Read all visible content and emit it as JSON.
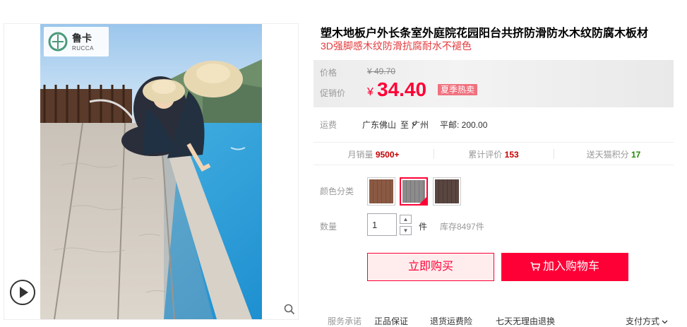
{
  "product": {
    "title": "塑木地板户外长条室外庭院花园阳台共挤防滑防水木纹防腐木板材",
    "subtitle": "3D强脚感木纹防滑抗腐耐水不褪色"
  },
  "brand": {
    "name_cn": "鲁卡",
    "name_en": "RUCCA"
  },
  "price": {
    "original_label": "价格",
    "original_value": "¥ 49.70",
    "promo_label": "促销价",
    "currency": "¥",
    "promo_value": "34.40",
    "promo_tag": "夏季热卖"
  },
  "shipping": {
    "label": "运费",
    "from": "广东佛山",
    "to_label": "至",
    "to": "广州",
    "fee": "平邮: 200.00"
  },
  "stats": {
    "monthly_sales_label": "月销量",
    "monthly_sales_value": "9500+",
    "reviews_label": "累计评价",
    "reviews_value": "153",
    "points_label": "送天猫积分",
    "points_value": "17"
  },
  "sku": {
    "color_label": "颜色分类",
    "colors": [
      {
        "swatch": "#8a5a44",
        "selected": false
      },
      {
        "swatch": "#8c8c8c",
        "selected": true
      },
      {
        "swatch": "#5a4640",
        "selected": false
      }
    ]
  },
  "quantity": {
    "label": "数量",
    "value": "1",
    "unit": "件",
    "stock": "库存8497件"
  },
  "actions": {
    "buy_now": "立即购买",
    "add_to_cart": "加入购物车"
  },
  "service": {
    "label": "服务承诺",
    "items": [
      "正品保证",
      "退货运费险",
      "七天无理由退换"
    ],
    "payment": "支付方式"
  },
  "icons": [
    "play-icon",
    "zoom-icon",
    "chevron-down-icon",
    "cart-icon"
  ],
  "colors": {
    "accent": "#ff0036",
    "price_bg": "#ececec",
    "tag": "#f0717f"
  }
}
